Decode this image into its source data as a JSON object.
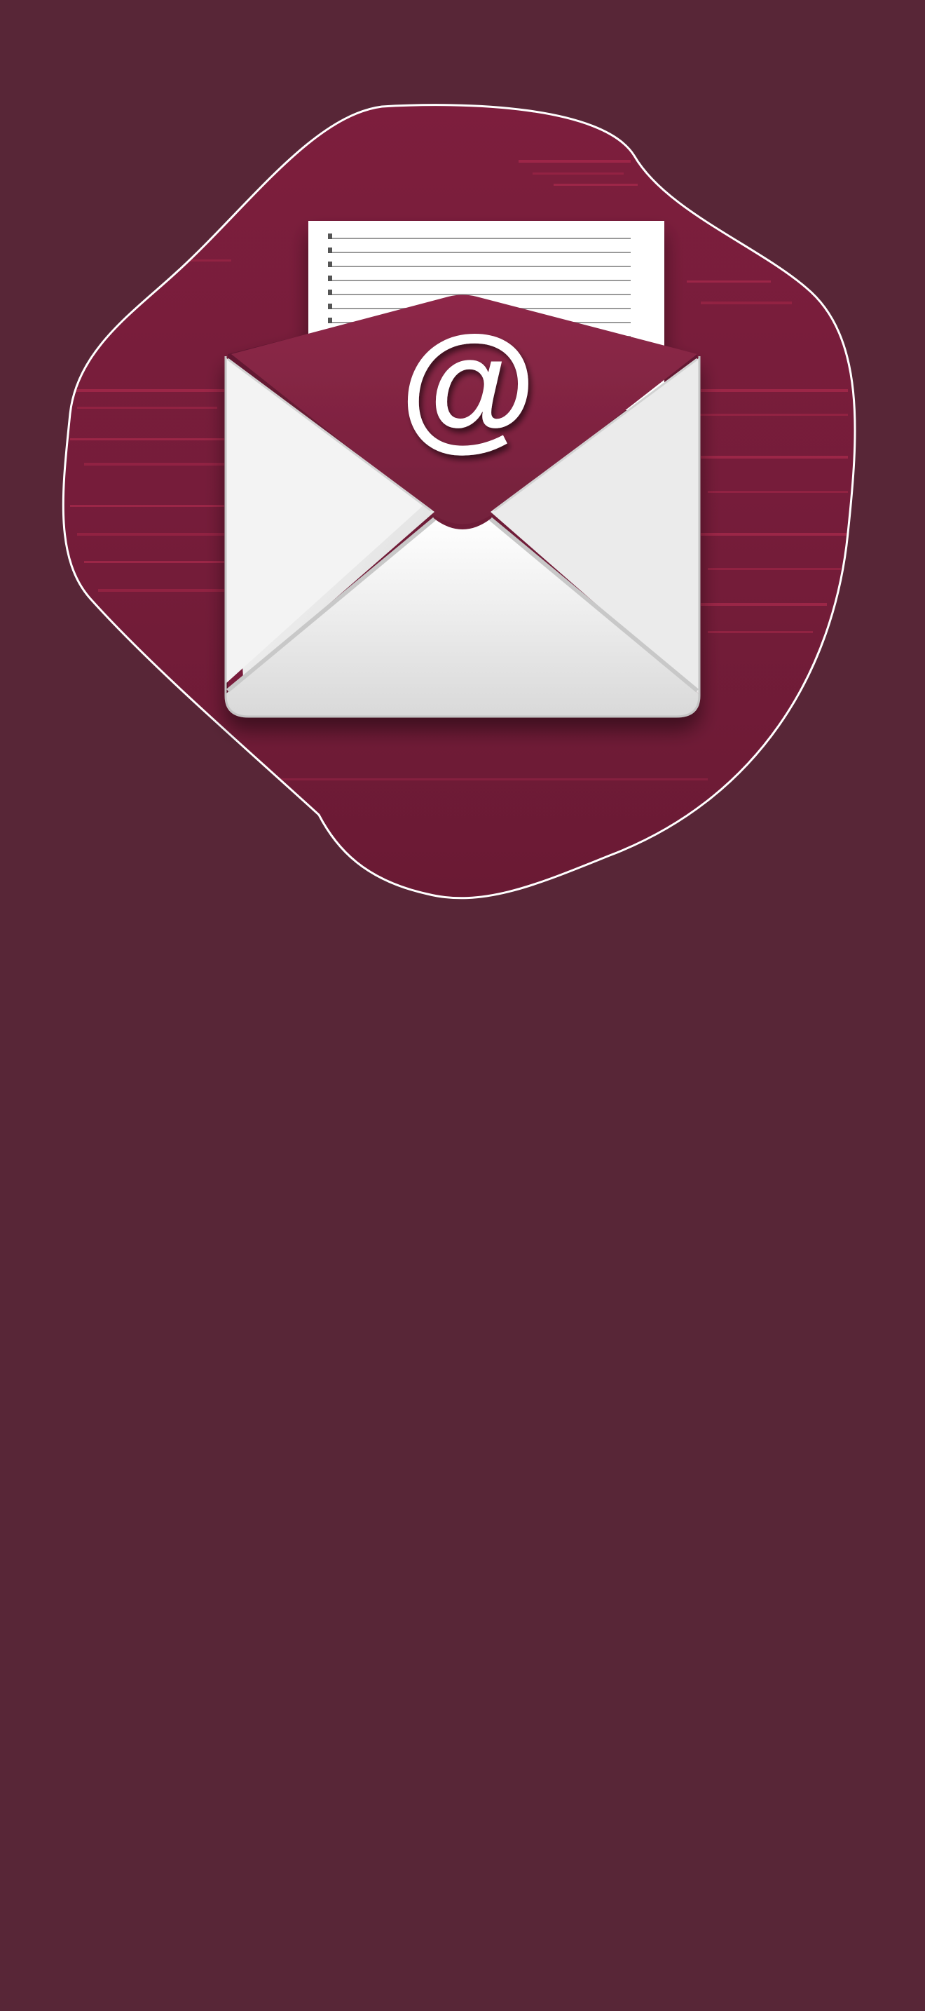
{
  "screen": {
    "background_color": "#582637"
  },
  "hero": {
    "blob_color": "#7a1f3c",
    "blob_outline_color": "#ffffff",
    "streak_color": "#a82a4c",
    "envelope_color": "#ededed",
    "envelope_shadow_color": "#c9c9c9",
    "flap_color": "#822543",
    "letter_color": "#ffffff",
    "at_symbol": "@",
    "at_symbol_color": "#ffffff",
    "icon": "email-envelope-icon"
  }
}
